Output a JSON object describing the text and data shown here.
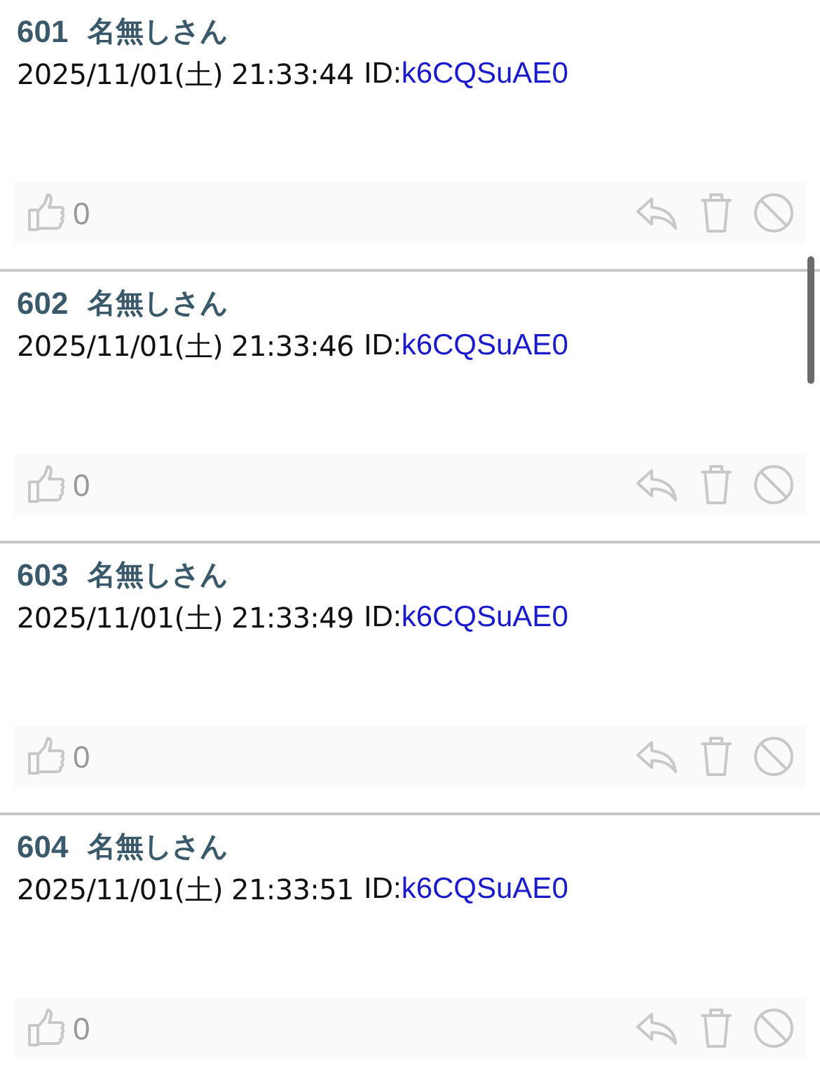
{
  "posts": [
    {
      "number": "601",
      "name": "名無しさん",
      "date": "2025/11/01(土) 21:33:44",
      "id_label": "ID:",
      "id": "k6CQSuAE0",
      "likes": "0"
    },
    {
      "number": "602",
      "name": "名無しさん",
      "date": "2025/11/01(土) 21:33:46",
      "id_label": "ID:",
      "id": "k6CQSuAE0",
      "likes": "0"
    },
    {
      "number": "603",
      "name": "名無しさん",
      "date": "2025/11/01(土) 21:33:49",
      "id_label": "ID:",
      "id": "k6CQSuAE0",
      "likes": "0"
    },
    {
      "number": "604",
      "name": "名無しさん",
      "date": "2025/11/01(土) 21:33:51",
      "id_label": "ID:",
      "id": "k6CQSuAE0",
      "likes": "0"
    }
  ]
}
